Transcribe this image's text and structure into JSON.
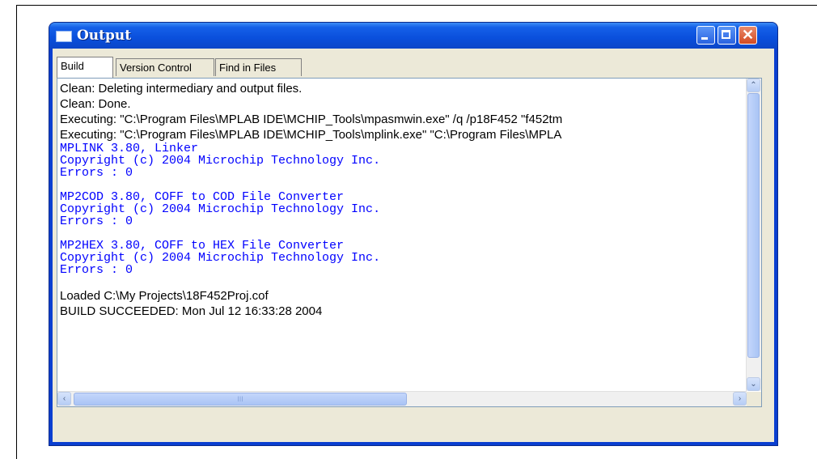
{
  "window": {
    "title": "Output",
    "close_glyph": "✕"
  },
  "tabs": [
    {
      "label": "Build",
      "active": true
    },
    {
      "label": "Version Control",
      "active": false
    },
    {
      "label": "Find in Files",
      "active": false
    }
  ],
  "output": {
    "lines": [
      {
        "text": "Clean: Deleting intermediary and output files.",
        "style": "plain"
      },
      {
        "text": "Clean: Done.",
        "style": "plain"
      },
      {
        "text": "Executing: \"C:\\Program Files\\MPLAB IDE\\MCHIP_Tools\\mpasmwin.exe\" /q /p18F452 \"f452tm",
        "style": "plain"
      },
      {
        "text": "Executing: \"C:\\Program Files\\MPLAB IDE\\MCHIP_Tools\\mplink.exe\" \"C:\\Program Files\\MPLA",
        "style": "plain"
      },
      {
        "text": "MPLINK 3.80, Linker",
        "style": "code"
      },
      {
        "text": "Copyright (c) 2004 Microchip Technology Inc.",
        "style": "code"
      },
      {
        "text": "Errors    : 0",
        "style": "code"
      },
      {
        "text": "",
        "style": "blank"
      },
      {
        "text": "MP2COD 3.80, COFF to COD File Converter",
        "style": "code"
      },
      {
        "text": "Copyright (c) 2004 Microchip Technology Inc.",
        "style": "code"
      },
      {
        "text": "Errors    : 0",
        "style": "code"
      },
      {
        "text": "",
        "style": "blank"
      },
      {
        "text": "MP2HEX 3.80, COFF to HEX File Converter",
        "style": "code"
      },
      {
        "text": "Copyright (c) 2004 Microchip Technology Inc.",
        "style": "code"
      },
      {
        "text": "Errors    : 0",
        "style": "code"
      },
      {
        "text": "",
        "style": "blank"
      },
      {
        "text": "Loaded C:\\My Projects\\18F452Proj.cof",
        "style": "plain"
      },
      {
        "text": "BUILD SUCCEEDED: Mon Jul 12 16:33:28 2004",
        "style": "plain"
      }
    ]
  },
  "scrollbars": {
    "up_glyph": "⌃",
    "down_glyph": "⌄",
    "left_glyph": "‹",
    "right_glyph": "›",
    "h_thumb_grip": "III"
  },
  "colors": {
    "compiler_output": "#0000ff",
    "plain_output": "#000000",
    "titlebar": "#0a4fdc"
  }
}
